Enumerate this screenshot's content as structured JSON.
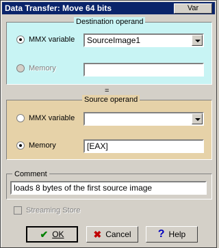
{
  "window": {
    "title": "Data Transfer: Move 64 bits",
    "var_label": "Var"
  },
  "destination": {
    "title": "Destination operand",
    "mmx_label": "MMX variable",
    "mmx_value": "SourceImage1",
    "memory_label": "Memory",
    "memory_value": "",
    "bg_color": "#c8f4f4"
  },
  "equals": "=",
  "source": {
    "title": "Source operand",
    "mmx_label": "MMX variable",
    "mmx_value": "",
    "memory_label": "Memory",
    "memory_value": "[EAX]",
    "bg_color": "#e6d2a8"
  },
  "comment": {
    "label": "Comment",
    "value": "loads 8 bytes of the first source image"
  },
  "streaming_store": {
    "label": "Streaming Store",
    "checked": false
  },
  "buttons": {
    "ok": "OK",
    "cancel": "Cancel",
    "help": "Help"
  },
  "icons": {
    "ok": "check-icon",
    "cancel": "x-icon",
    "help": "question-icon"
  },
  "colors": {
    "ok_icon": "#008000",
    "cancel_icon": "#c00000",
    "help_icon": "#0000c0"
  }
}
